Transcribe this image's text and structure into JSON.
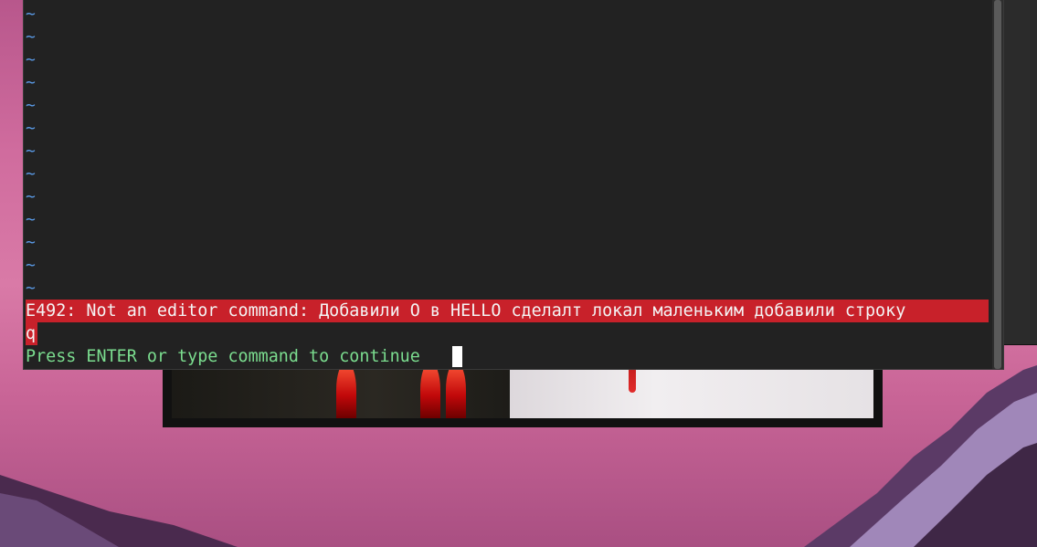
{
  "vim": {
    "empty_line_marker": "~",
    "error_line": "E492: Not an editor command: Добавили O в HELLO сделалт локал маленьким добавили строку",
    "error_continuation": "q",
    "prompt": "Press ENTER or type command to continue"
  },
  "colors": {
    "terminal_bg": "#222222",
    "tilde": "#5a9ae6",
    "error_bg": "#c8212a",
    "prompt_text": "#7bdd8f"
  }
}
